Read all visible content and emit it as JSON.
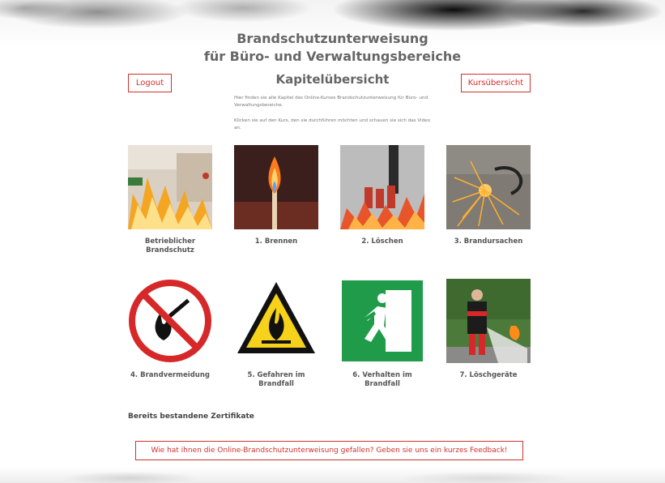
{
  "header": {
    "title_line1": "Brandschutzunterweisung",
    "title_line2": "für Büro- und Verwaltungsbereiche",
    "subtitle": "Kapitelübersicht"
  },
  "nav": {
    "logout_label": "Logout",
    "courses_label": "Kursübersicht"
  },
  "intro": {
    "paragraph1": "Hier finden sie alle Kapitel des Online-Kurses Brandschutzunterweisung für Büro- und Verwaltungsbereiche.",
    "paragraph2": "Klicken sie auf den Kurs, den sie durchführen möchten und schauen sie sich das Video an."
  },
  "chapters": [
    {
      "label": "Betrieblicher Brandschutz",
      "icon": "office-fire-photo"
    },
    {
      "label": "1. Brennen",
      "icon": "burning-match-photo"
    },
    {
      "label": "2. Löschen",
      "icon": "fire-extinguishers-photo"
    },
    {
      "label": "3. Brandursachen",
      "icon": "sparks-photo"
    },
    {
      "label": "4. Brandvermeidung",
      "icon": "no-open-flame-sign"
    },
    {
      "label": "5. Gefahren im Brandfall",
      "icon": "flammable-warning-sign"
    },
    {
      "label": "6. Verhalten im Brandfall",
      "icon": "emergency-exit-sign"
    },
    {
      "label": "7. Löschgeräte",
      "icon": "extinguisher-use-photo"
    }
  ],
  "certificates": {
    "heading": "Bereits bestandene Zertifikate"
  },
  "feedback": {
    "label": "Wie hat ihnen die Online-Brandschutzunterweisung gefallen? Geben sie uns ein kurzes Feedback!"
  },
  "colors": {
    "accent": "#d0312d",
    "text": "#555555"
  }
}
